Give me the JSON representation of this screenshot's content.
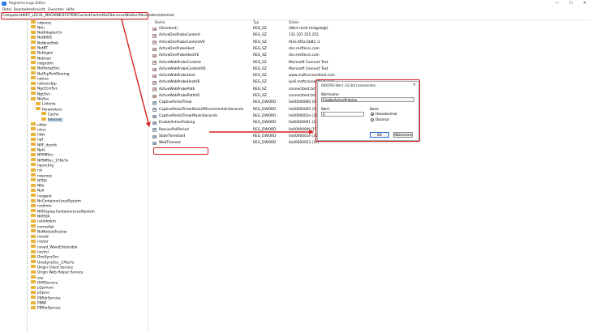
{
  "window": {
    "title": "Registrierungs-Editor",
    "controls": [
      "—",
      "☐",
      "✕"
    ]
  },
  "menu": [
    "Datei",
    "Bearbeiten",
    "Ansicht",
    "Favoriten",
    "Hilfe"
  ],
  "address": "Computer\\HKEY_LOCAL_MACHINE\\SYSTEM\\CurrentControlSet\\Services\\NlaSvc\\Parameters\\Internet",
  "tree": [
    {
      "label": "ndproxy"
    },
    {
      "label": "Ndu"
    },
    {
      "label": "NetAdapterCx"
    },
    {
      "label": "NetBIOS"
    },
    {
      "label": "NetbiosSmb"
    },
    {
      "label": "NetBT"
    },
    {
      "label": "Netlogon"
    },
    {
      "label": "Netman"
    },
    {
      "label": "netprofm"
    },
    {
      "label": "NetSetupSvc"
    },
    {
      "label": "NetTcpPortSharing"
    },
    {
      "label": "netvsc"
    },
    {
      "label": "netvscvfpp"
    },
    {
      "label": "NgcCtnrSvc"
    },
    {
      "label": "NgcSvc"
    },
    {
      "label": "NlaSvc"
    },
    {
      "label": "LinkIrds"
    },
    {
      "label": "Parameters"
    },
    {
      "label": "Cache"
    },
    {
      "label": "Internet"
    },
    {
      "label": "nldev"
    },
    {
      "label": "nlsvc"
    },
    {
      "label": "nlwt"
    },
    {
      "label": "npf"
    },
    {
      "label": "NPF_dsncfc"
    },
    {
      "label": "Npfs"
    },
    {
      "label": "NPSMSvc"
    },
    {
      "label": "NPSMSvc_176e7e"
    },
    {
      "label": "npsvctrig"
    },
    {
      "label": "nsi"
    },
    {
      "label": "nsiproxy"
    },
    {
      "label": "NTDS"
    },
    {
      "label": "Ntfs"
    },
    {
      "label": "Null"
    },
    {
      "label": "nvagent"
    },
    {
      "label": "NvContainerLocalSystem"
    },
    {
      "label": "nvdimm"
    },
    {
      "label": "NVDisplay.ContainerLocalSystem"
    },
    {
      "label": "NVHDA"
    },
    {
      "label": "nvlddmkm"
    },
    {
      "label": "nvmedisk"
    },
    {
      "label": "NvModuleTracker"
    },
    {
      "label": "nvraid"
    },
    {
      "label": "nvstor"
    },
    {
      "label": "nvvad_WaveExtensible"
    },
    {
      "label": "nvvhci"
    },
    {
      "label": "OneSyncSvc"
    },
    {
      "label": "OneSyncSvc_176e7e"
    },
    {
      "label": "Origin Client Service"
    },
    {
      "label": "Origin Web Helper Service"
    },
    {
      "label": "ose"
    },
    {
      "label": "OVRService"
    },
    {
      "label": "p2pimsvc"
    },
    {
      "label": "p2psvc"
    },
    {
      "label": "P9RdrService"
    },
    {
      "label": "P9NP"
    },
    {
      "label": "P9RdrService"
    }
  ],
  "list": {
    "headers": {
      "name": "Name",
      "type": "Typ",
      "data": "Daten"
    },
    "rows": [
      {
        "name": "(Standard)",
        "type": "REG_SZ",
        "data": "(Wert nicht festgelegt)",
        "kind": "ab"
      },
      {
        "name": "ActiveDnsProbeContent",
        "type": "REG_SZ",
        "data": "131.107.255.255",
        "kind": "ab"
      },
      {
        "name": "ActiveDnsProbeContentV6",
        "type": "REG_SZ",
        "data": "fd3e:4f5a:5b81::1",
        "kind": "ab"
      },
      {
        "name": "ActiveDnsProbeHost",
        "type": "REG_SZ",
        "data": "dns.msftncsi.com",
        "kind": "ab"
      },
      {
        "name": "ActiveDnsProbeHostV6",
        "type": "REG_SZ",
        "data": "dns.msftncsi.com",
        "kind": "ab"
      },
      {
        "name": "ActiveWebProbeContent",
        "type": "REG_SZ",
        "data": "Microsoft Connect Test",
        "kind": "ab"
      },
      {
        "name": "ActiveWebProbeContentV6",
        "type": "REG_SZ",
        "data": "Microsoft Connect Test",
        "kind": "ab"
      },
      {
        "name": "ActiveWebProbeHost",
        "type": "REG_SZ",
        "data": "www.msftconnecttest.com",
        "kind": "ab"
      },
      {
        "name": "ActiveWebProbeHostV6",
        "type": "REG_SZ",
        "data": "ipv6.msftconnecttest.com",
        "kind": "ab"
      },
      {
        "name": "ActiveWebProbePath",
        "type": "REG_SZ",
        "data": "connecttest.txt",
        "kind": "ab"
      },
      {
        "name": "ActiveWebProbePathV6",
        "type": "REG_SZ",
        "data": "connecttest.txt",
        "kind": "ab"
      },
      {
        "name": "CaptivePortalTimer",
        "type": "REG_DWORD",
        "data": "0x00000000 (0)",
        "kind": "dw"
      },
      {
        "name": "CaptivePortalTimerBackOffIncrementsInSeconds",
        "type": "REG_DWORD",
        "data": "0x00000005 (5)",
        "kind": "dw"
      },
      {
        "name": "CaptivePortalTimerMaxInSeconds",
        "type": "REG_DWORD",
        "data": "0x0000001e (30)",
        "kind": "dw"
      },
      {
        "name": "EnableActiveProbing",
        "type": "REG_DWORD",
        "data": "0x00000001 (1)",
        "kind": "dw"
      },
      {
        "name": "PassivePollPeriod",
        "type": "REG_DWORD",
        "data": "0x0000000f (15)",
        "kind": "dw"
      },
      {
        "name": "StaleThreshold",
        "type": "REG_DWORD",
        "data": "0x0000001e (30)",
        "kind": "dw"
      },
      {
        "name": "WebTimeout",
        "type": "REG_DWORD",
        "data": "0x00000023 (35)",
        "kind": "dw"
      }
    ]
  },
  "dialog": {
    "title": "DWORD-Wert (32-Bit) bearbeiten",
    "close": "✕",
    "name_label": "Wertname:",
    "name_value": "EnableActiveProbing",
    "value_label": "Wert:",
    "value_value": "0",
    "base_label": "Basis",
    "hex_label": "Hexadezimal",
    "dec_label": "Dezimal",
    "ok_label": "OK",
    "cancel_label": "Abbrechen"
  }
}
